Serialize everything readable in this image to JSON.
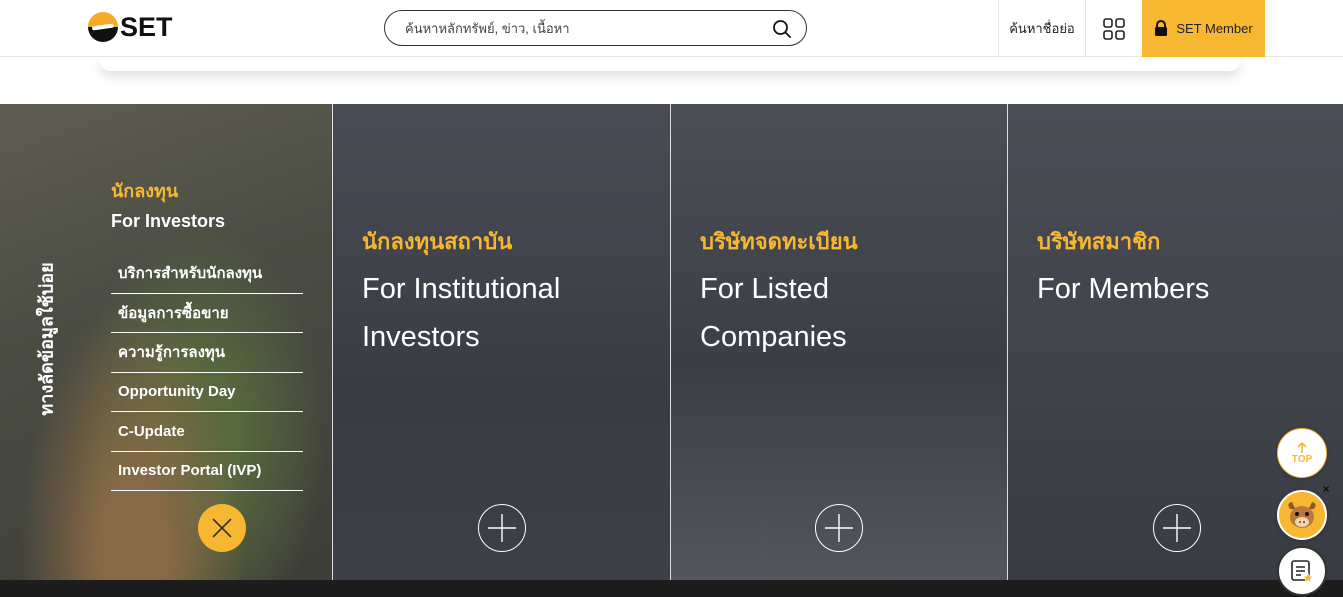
{
  "header": {
    "logo_text": "SET",
    "search_placeholder": "ค้นหาหลักทรัพย์, ข่าว, เนื้อหา",
    "abbr_search_label": "ค้นหาชื่อย่อ",
    "member_label": "SET Member"
  },
  "quick_links": {
    "vertical_label": "ทางลัดข้อมูลใช้บ่อย",
    "investors": {
      "title_th": "นักลงทุน",
      "title_en": "For Investors",
      "items": [
        {
          "label": "บริการสำหรับนักลงทุน"
        },
        {
          "label": "ข้อมูลการซื้อขาย"
        },
        {
          "label": "ความรู้การลงทุน"
        },
        {
          "label": "Opportunity Day"
        },
        {
          "label": "C-Update"
        },
        {
          "label": "Investor Portal (IVP)"
        }
      ]
    },
    "panels": [
      {
        "title_th": "นักลงทุนสถาบัน",
        "title_en_1": "For Institutional",
        "title_en_2": "Investors"
      },
      {
        "title_th": "บริษัทจดทะเบียน",
        "title_en_1": "For Listed",
        "title_en_2": "Companies"
      },
      {
        "title_th": "บริษัทสมาชิก",
        "title_en_1": "For Members",
        "title_en_2": ""
      }
    ]
  },
  "floating": {
    "top_label": "TOP",
    "close_glyph": "×"
  },
  "colors": {
    "accent": "#f7b731",
    "dark": "#1d1d1d"
  },
  "icons": [
    "search-icon",
    "grid-icon",
    "lock-icon",
    "close-icon",
    "plus-icon",
    "arrow-up-icon",
    "mascot-icon",
    "favorite-list-icon"
  ]
}
